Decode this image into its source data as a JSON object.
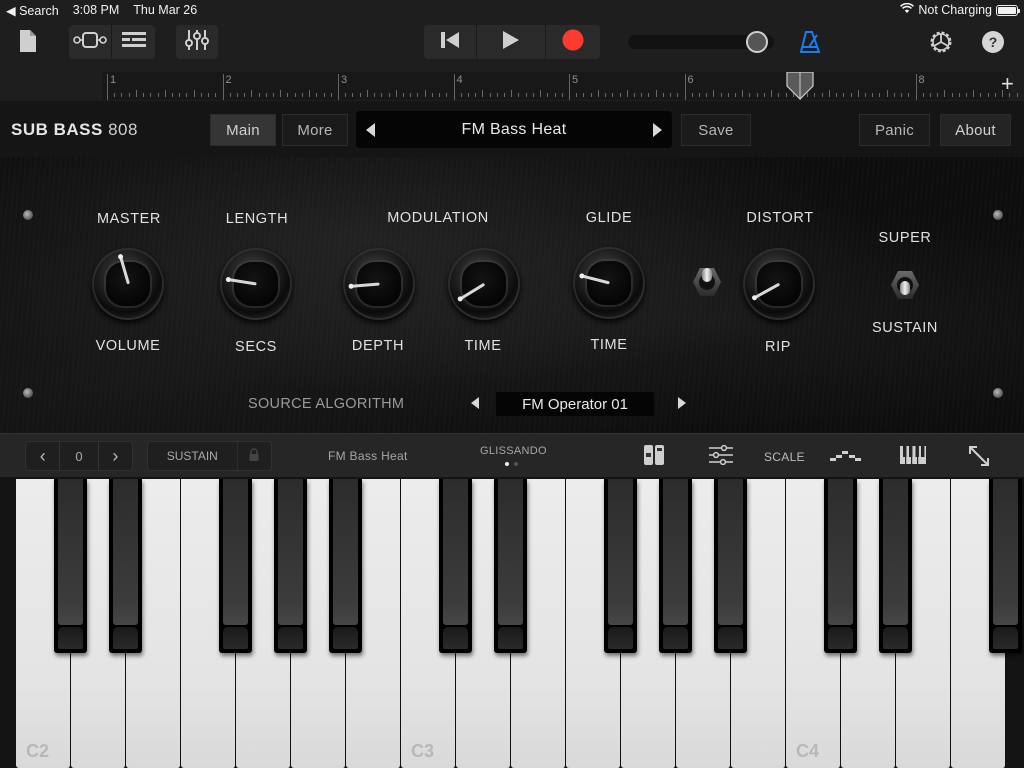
{
  "status_bar": {
    "back_label": "◀ Search",
    "time": "3:08 PM",
    "date": "Thu Mar 26",
    "charging": "Not Charging",
    "battery_level_pct": 100
  },
  "toolbar": {
    "icons": {
      "document": "document-icon",
      "tracks_view": "tracks-view-icon",
      "list_view": "list-view-icon",
      "mixer": "mixer-sliders-icon",
      "rewind": "go-to-start-icon",
      "play": "play-icon",
      "record": "record-icon",
      "metronome": "metronome-icon",
      "settings": "gear-icon",
      "help": "help-icon"
    },
    "volume_pct": 95,
    "record_color": "#ff3b30",
    "metronome_color": "#1a7cf5"
  },
  "ruler": {
    "bars": [
      "1",
      "2",
      "3",
      "4",
      "5",
      "6",
      "7",
      "8"
    ],
    "playhead_bar": "7",
    "add_label": "+"
  },
  "plugin": {
    "title_bold": "SUB BASS",
    "title_num": "808",
    "tabs": [
      {
        "label": "Main",
        "active": true
      },
      {
        "label": "More",
        "active": false
      }
    ],
    "preset_name": "FM Bass Heat",
    "save_label": "Save",
    "panic_label": "Panic",
    "about_label": "About"
  },
  "panel": {
    "controls": [
      {
        "top": "MASTER",
        "bottom": "VOLUME",
        "type": "knob",
        "value_pct": 44
      },
      {
        "top": "LENGTH",
        "bottom": "SECS",
        "type": "knob",
        "value_pct": 20
      },
      {
        "top": "MODULATION",
        "bottom": "DEPTH",
        "type": "knob",
        "value_pct": 15
      },
      {
        "top": "",
        "bottom": "TIME",
        "type": "knob",
        "value_pct": 5
      },
      {
        "top": "GLIDE",
        "bottom": "TIME",
        "type": "knob",
        "value_pct": 22
      },
      {
        "top": "DISTORT",
        "bottom": "RIP",
        "type": "knob",
        "value_pct": 6
      },
      {
        "top": "SUPER",
        "bottom": "SUSTAIN",
        "type": "toggle",
        "state": "down"
      }
    ],
    "distort_toggle_state": "up",
    "algorithm_label": "SOURCE ALGORITHM",
    "algorithm_value": "FM Operator 01"
  },
  "keyboard_bar": {
    "octave_value": "0",
    "prev_label": "‹",
    "next_label": "›",
    "sustain_label": "SUSTAIN",
    "preset_name": "FM Bass Heat",
    "glissando_label": "GLISSANDO",
    "page_index": 1,
    "page_count": 2,
    "scale_label": "SCALE",
    "icons": {
      "lock": "lock-icon",
      "layout": "keyboard-layout-icon",
      "controls": "sliders-icon",
      "arpeggiator": "arpeggiator-icon",
      "keyboard": "piano-keys-icon",
      "expand": "expand-icon"
    }
  },
  "keyboard": {
    "octave_labels": [
      "C2",
      "C3",
      "C4"
    ]
  }
}
